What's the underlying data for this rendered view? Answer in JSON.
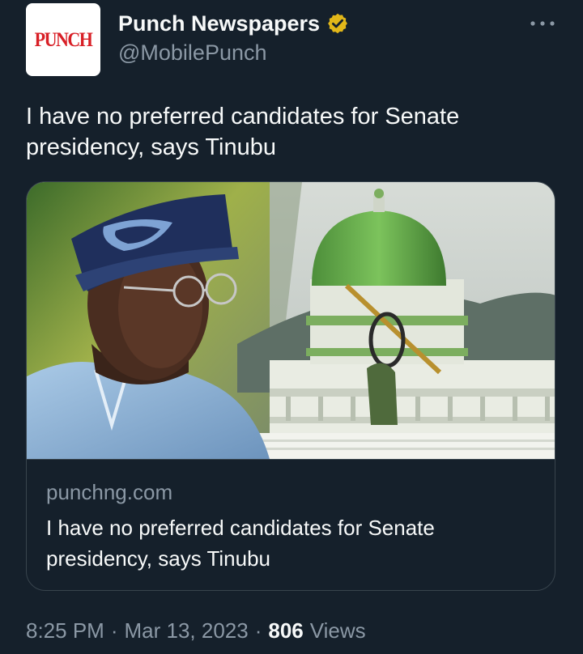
{
  "author": {
    "avatar_text": "PUNCH",
    "display_name": "Punch Newspapers",
    "handle": "@MobilePunch",
    "verified_badge_color": "#e2b719"
  },
  "tweet": {
    "text": "I have no preferred candidates for Senate presidency, says Tinubu"
  },
  "card": {
    "domain": "punchng.com",
    "title": "I have no preferred candidates for Senate presidency, says Tinubu"
  },
  "meta": {
    "time": "8:25 PM",
    "separator": "·",
    "date": "Mar 13, 2023",
    "views_count": "806",
    "views_label": "Views"
  },
  "colors": {
    "background": "#15202b",
    "text": "#f7f9f9",
    "secondary": "#8b98a5",
    "border": "#38444d",
    "brand_red": "#d81f26"
  }
}
